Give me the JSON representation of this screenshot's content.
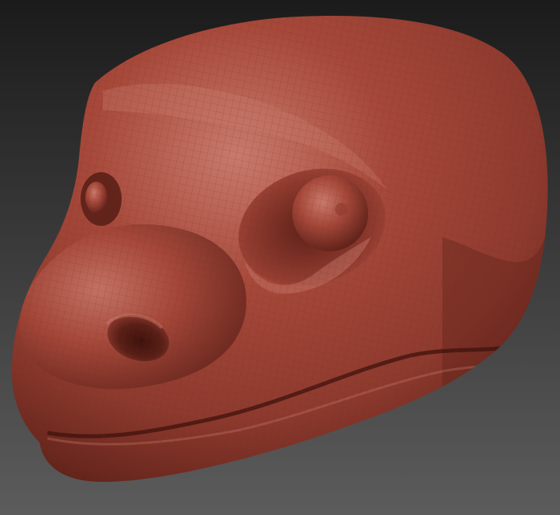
{
  "scene": {
    "subject": "sculpted-reptile-head",
    "colors": {
      "background_top": "#1b1b1b",
      "background_bottom": "#5c5c5c",
      "clay_highlight": "#c87a6c",
      "clay_base": "#a6483a",
      "clay_mid": "#8e3a2e",
      "clay_shadow": "#5a1f17",
      "clay_deep": "#3d120c",
      "wireframe": "#6e2a20"
    }
  }
}
